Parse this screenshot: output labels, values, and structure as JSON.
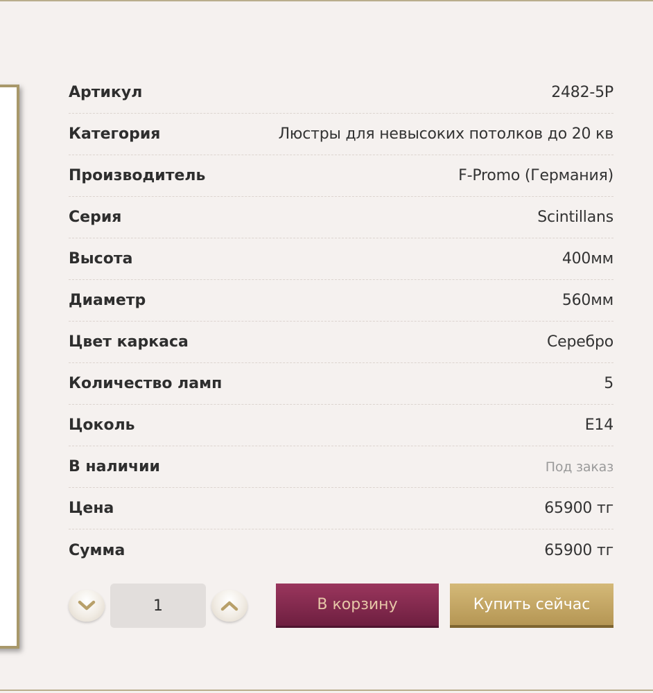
{
  "specs": [
    {
      "label": "Артикул",
      "value": "2482-5P"
    },
    {
      "label": "Категория",
      "value": "Люстры для невысоких потолков до 20 кв"
    },
    {
      "label": "Производитель",
      "value": "F-Promo (Германия)"
    },
    {
      "label": "Серия",
      "value": "Scintillans"
    },
    {
      "label": "Высота",
      "value": "400мм"
    },
    {
      "label": "Диаметр",
      "value": "560мм"
    },
    {
      "label": "Цвет каркаса",
      "value": "Серебро"
    },
    {
      "label": "Количество ламп",
      "value": "5"
    },
    {
      "label": "Цоколь",
      "value": "E14"
    },
    {
      "label": "В наличии",
      "value": "Под заказ"
    },
    {
      "label": "Цена",
      "value": "65900 тг"
    },
    {
      "label": "Сумма",
      "value": "65900 тг"
    }
  ],
  "quantity": {
    "value": "1",
    "decrease_icon": "chevron-down-icon",
    "increase_icon": "chevron-up-icon"
  },
  "actions": {
    "add_to_cart_label": "В корзину",
    "buy_now_label": "Купить сейчас"
  },
  "colors": {
    "background": "#f5f1ef",
    "cart_button": "#8a2d52",
    "buy_button": "#c9ac69",
    "chevron": "#b8a06a"
  }
}
